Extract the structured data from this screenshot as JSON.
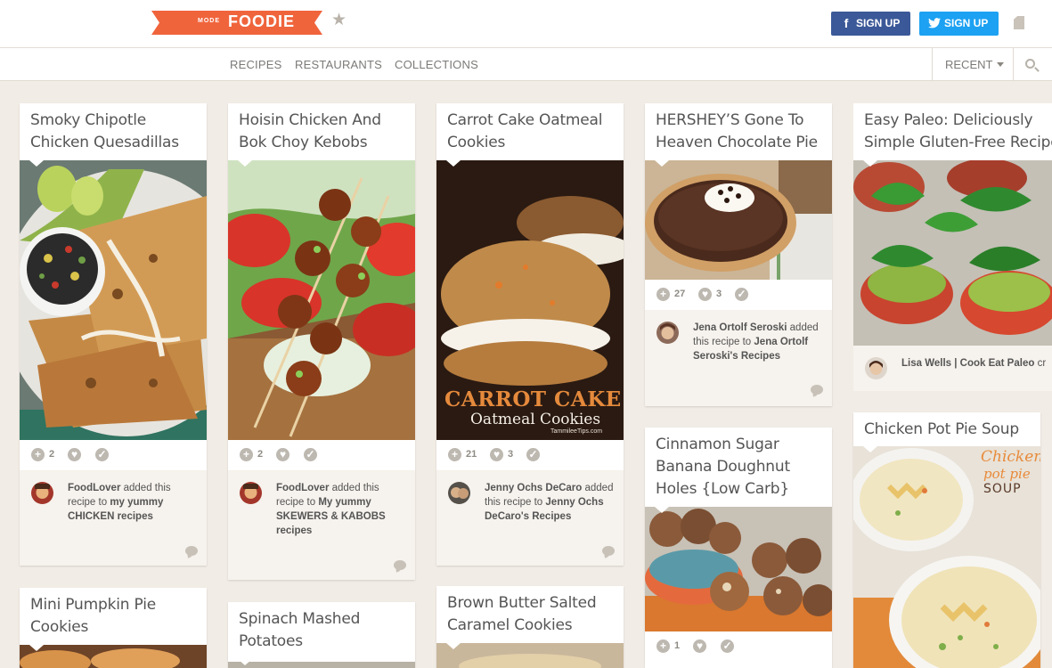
{
  "header": {
    "logo_mode": "MODE",
    "logo_name": "FOODIE",
    "facebook_signup": "SIGN UP",
    "twitter_signup": "SIGN UP"
  },
  "nav": {
    "recipes": "RECIPES",
    "restaurants": "RESTAURANTS",
    "collections": "COLLECTIONS",
    "sort": "RECENT"
  },
  "colors": {
    "brand": "#f0643c",
    "facebook": "#3b5998",
    "twitter": "#1da1f2",
    "background": "#f1ece5"
  },
  "cards": [
    {
      "title": "Smoky Chipotle Chicken Quesadillas",
      "adds": "2",
      "user": "FoodLover",
      "verb": " added this recipe to ",
      "collection": "my yummy CHICKEN recipes"
    },
    {
      "title": "Hoisin Chicken And Bok Choy Kebobs",
      "adds": "2",
      "user": "FoodLover",
      "verb": " added this recipe to ",
      "collection": "My yummy SKEWERS & KABOBS recipes"
    },
    {
      "title": "Carrot Cake Oatmeal Cookies",
      "adds": "21",
      "likes": "3",
      "user": "Jenny Ochs DeCaro",
      "verb": " added this recipe to ",
      "collection": "Jenny Ochs DeCaro's Recipes",
      "photo_text_1": "CARROT CAKE",
      "photo_text_2": "Oatmeal Cookies",
      "photo_text_3": "TammileeTips.com"
    },
    {
      "title": "HERSHEY’S Gone To Heaven Chocolate Pie",
      "adds": "27",
      "likes": "3",
      "user": "Jena Ortolf Seroski",
      "verb": " added this recipe to ",
      "collection": "Jena Ortolf Seroski's Recipes"
    },
    {
      "title": "Easy Paleo: Deliciously Simple Gluten-Free Recipes",
      "user": "Lisa Wells | Cook Eat Paleo",
      "verb": " cr"
    },
    {
      "title": "Cinnamon Sugar Banana Doughnut Holes {Low Carb}",
      "adds": "1"
    },
    {
      "title": "Chicken Pot Pie Soup",
      "photo_text_1": "Chicken",
      "photo_text_2": "pot pie",
      "photo_text_3": "SOUP"
    },
    {
      "title": "Mini Pumpkin Pie Cookies"
    },
    {
      "title": "Spinach Mashed Potatoes"
    },
    {
      "title": "Brown Butter Salted Caramel Cookies"
    }
  ],
  "icons": {
    "add": "plus-circle-icon",
    "like": "heart-icon",
    "made": "check-circle-icon",
    "comment": "speech-bubble-icon"
  }
}
